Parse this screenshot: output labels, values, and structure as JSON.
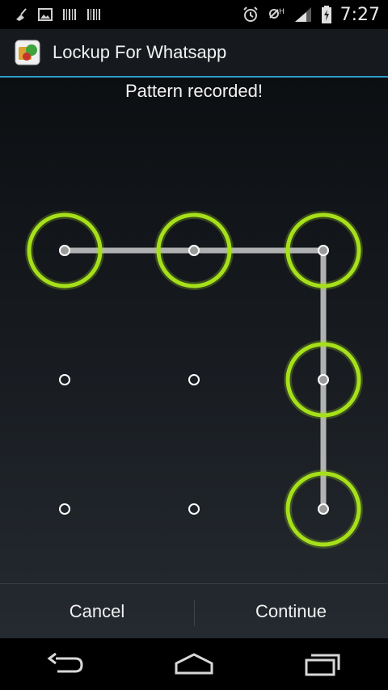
{
  "status_bar": {
    "time": "7:27",
    "icons": [
      "broom-icon",
      "image-icon",
      "barcode-icon",
      "barcode-icon",
      "alarm-icon",
      "mute-icon",
      "signal-icon",
      "battery-charging-icon"
    ]
  },
  "action_bar": {
    "app_title": "Lockup For Whatsapp",
    "app_icon": "lockup-app-icon"
  },
  "pattern_screen": {
    "message": "Pattern recorded!",
    "grid": {
      "rows": 3,
      "cols": 3
    },
    "selected_sequence": [
      1,
      2,
      3,
      6,
      9
    ],
    "active_color": "#a6e01a",
    "line_color": "#d7d7d7"
  },
  "buttons": {
    "cancel": "Cancel",
    "continue": "Continue"
  },
  "nav_bar": {
    "back": "back-icon",
    "home": "home-icon",
    "recents": "recents-icon"
  }
}
